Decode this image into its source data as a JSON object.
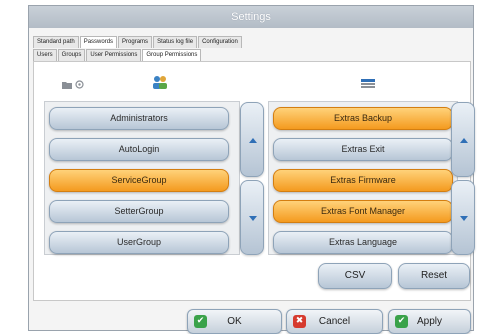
{
  "window": {
    "title": "Settings"
  },
  "tabs_top": [
    {
      "label": "Standard path"
    },
    {
      "label": "Passwords"
    },
    {
      "label": "Programs"
    },
    {
      "label": "Status log file"
    },
    {
      "label": "Configuration"
    }
  ],
  "tabs_sub": [
    {
      "label": "Users"
    },
    {
      "label": "Groups"
    },
    {
      "label": "User Permissions"
    },
    {
      "label": "Group Permissions"
    }
  ],
  "toolbar": {
    "left_icons": [
      "folder-icon",
      "key-icon",
      "users-group-icon"
    ],
    "right_icon": "permissions-icon"
  },
  "groups": {
    "items": [
      {
        "label": "Administrators",
        "selected": false
      },
      {
        "label": "AutoLogin",
        "selected": false
      },
      {
        "label": "ServiceGroup",
        "selected": true
      },
      {
        "label": "SetterGroup",
        "selected": false
      },
      {
        "label": "UserGroup",
        "selected": false
      }
    ]
  },
  "permissions": {
    "items": [
      {
        "label": "Extras Backup",
        "selected": true
      },
      {
        "label": "Extras Exit",
        "selected": false
      },
      {
        "label": "Extras Firmware",
        "selected": true
      },
      {
        "label": "Extras Font Manager",
        "selected": true
      },
      {
        "label": "Extras Language",
        "selected": false
      }
    ]
  },
  "buttons": {
    "csv": "CSV",
    "reset": "Reset"
  },
  "footer": {
    "ok": "OK",
    "cancel": "Cancel",
    "apply": "Apply"
  },
  "colors": {
    "accent": "#f49a1f",
    "ok_icon": "#3aa24a",
    "cancel_icon": "#d63a2e",
    "apply_icon": "#3aa24a"
  }
}
